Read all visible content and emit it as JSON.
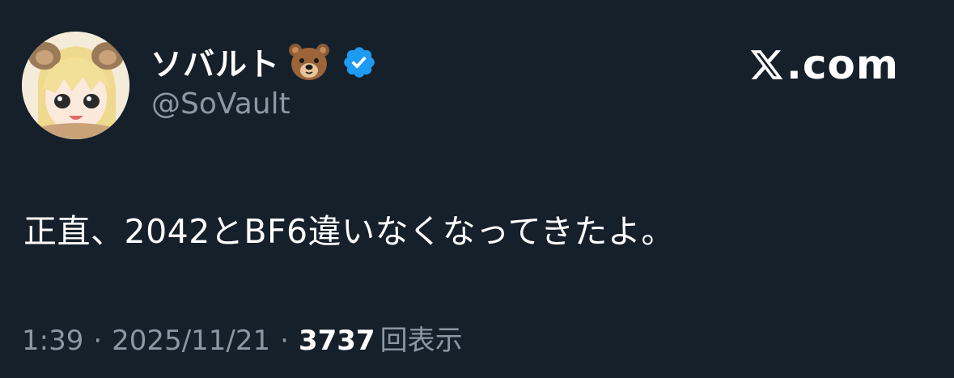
{
  "author": {
    "display_name": "ソバルト",
    "display_name_emoji": "bear-face-emoji",
    "handle": "@SoVault",
    "verified": true,
    "avatar": "anime-avatar-blonde-bear-hood"
  },
  "brand": {
    "logo": "x-logo",
    "text": ".com"
  },
  "tweet": {
    "text": "正直、2042とBF6違いなくなってきたよ。"
  },
  "meta": {
    "time": "1:39",
    "separator": "·",
    "date": "2025/11/21",
    "views_count": "3737",
    "views_label": "回表示"
  },
  "colors": {
    "background": "#15202b",
    "primary_text": "#ffffff",
    "secondary_text": "#8b98a5",
    "verified_badge": "#1d9bf0"
  }
}
